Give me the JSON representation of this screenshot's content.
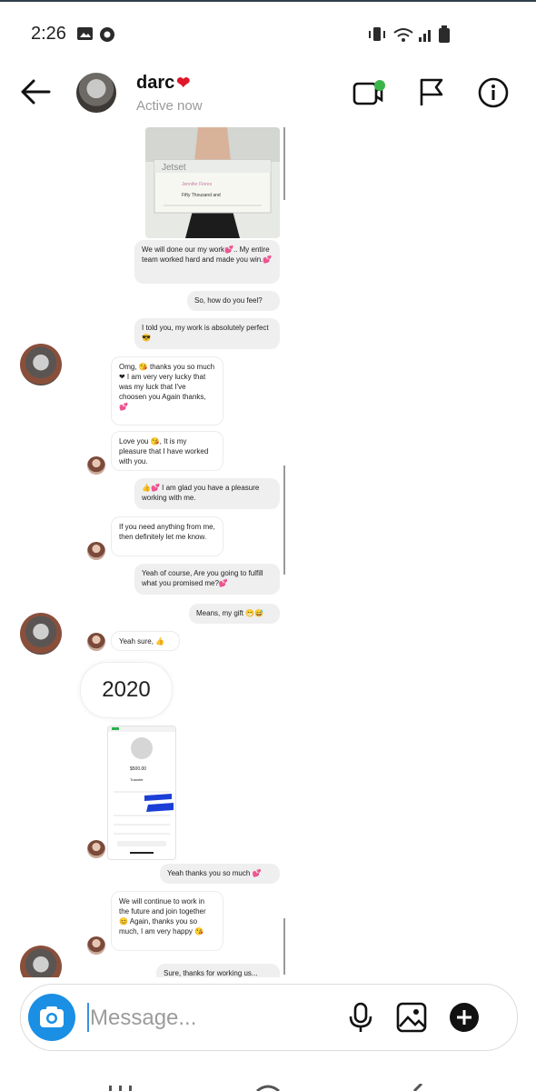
{
  "status_bar": {
    "time": "2:26"
  },
  "header": {
    "name": "darc",
    "heart": "❤",
    "status": "Active now"
  },
  "messages": {
    "m1": "We will done our my work💕.. My entire team worked hard and made you win.💕",
    "m2": "So, how do you feel?",
    "m3": "I told you, my work is absolutely perfect 😎",
    "m4": "Omg, 😘 thanks you so much ❤ I am very very lucky that was my luck that I've choosen you Again thanks, 💕",
    "m5": "Love you 😘, It is my pleasure that I have worked with you.",
    "m6": "👍💕 I am glad you have a pleasure working with me.",
    "m7": "If you need anything from me, then definitely let me know.",
    "m8": "Yeah of course, Are you going to fulfill what you promised me?💕",
    "m9": "Means, my gift 😁😅",
    "m10": "Yeah sure, 👍",
    "m11": "Yeah thanks you so much 💕",
    "m12": "We will continue to work in the future and join together 😊 Again, thanks you so much, I am very happy 😘",
    "m13": "Sure, thanks for working us..."
  },
  "check_image": {
    "brand": "Jetset",
    "line1": "Jennifer Flores",
    "line2": "Fifty Thousand and",
    "amount": "$50,000"
  },
  "year_label": "2020",
  "screenshot_thumb": {
    "amount": "$500.00",
    "name": "Transfer"
  },
  "composer": {
    "placeholder": "Message..."
  },
  "icons": {
    "back": "arrow-left-icon",
    "video": "video-call-icon",
    "flag": "flag-icon",
    "info": "info-icon",
    "camera": "camera-icon",
    "mic": "microphone-icon",
    "gallery": "gallery-icon",
    "plus": "plus-icon"
  },
  "colors": {
    "camera_button": "#1a8fe3",
    "online_dot": "#3bb54a",
    "heart": "#e0162b"
  }
}
